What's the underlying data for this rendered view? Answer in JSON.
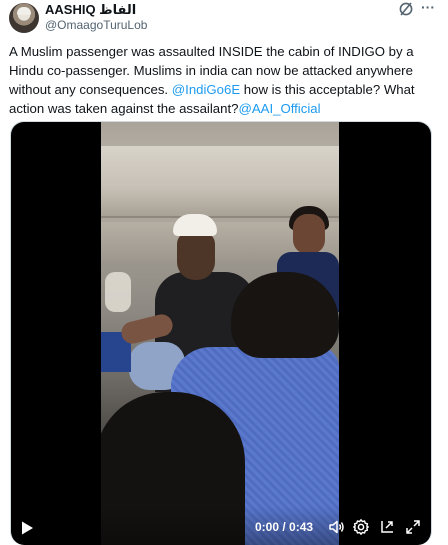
{
  "author": {
    "display_name": "AASHIQ الفاظ",
    "handle": "@OmaagoTuruLob"
  },
  "tweet": {
    "text_1": "A Muslim passenger was assaulted INSIDE the cabin of INDIGO by a Hindu co-passenger. Muslims in india can now be attacked anywhere without any consequences. ",
    "mention_1": "@IndiGo6E",
    "text_2": " how is this acceptable? What action was taken against the assailant?",
    "mention_2": "@AAI_Official"
  },
  "video": {
    "time_display": "0:00 / 0:43"
  },
  "icons": {
    "grok": "grok-icon",
    "more": "more-icon",
    "play": "play-icon",
    "volume": "volume-icon",
    "settings": "settings-icon",
    "pip": "picture-in-picture-icon",
    "fullscreen": "fullscreen-icon"
  },
  "colors": {
    "link": "#1d9bf0",
    "text": "#0f1419",
    "secondary_text": "#536471"
  }
}
